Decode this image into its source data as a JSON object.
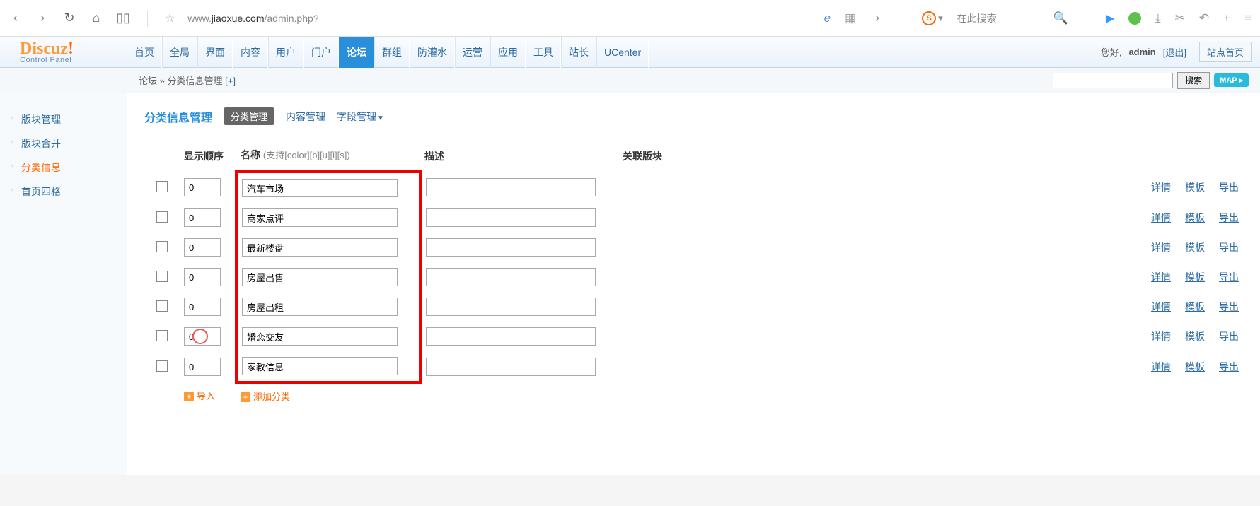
{
  "browser": {
    "url_pre": "www.",
    "url_host": "jiaoxue.com",
    "url_path": "/admin.php?",
    "search_placeholder": "在此搜索"
  },
  "header": {
    "nav": [
      "首页",
      "全局",
      "界面",
      "内容",
      "用户",
      "门户",
      "论坛",
      "群组",
      "防灌水",
      "运营",
      "应用",
      "工具",
      "站长",
      "UCenter"
    ],
    "active_index": 6,
    "greeting": "您好,",
    "user": "admin",
    "logout": "[退出]",
    "site_home": "站点首页"
  },
  "breadcrumb": {
    "part1": "论坛",
    "sep": " » ",
    "part2": "分类信息管理",
    "plus": " [+]",
    "search_btn": "搜索",
    "map": "MAP"
  },
  "sidebar": {
    "items": [
      {
        "label": "版块管理"
      },
      {
        "label": "版块合并"
      },
      {
        "label": "分类信息"
      },
      {
        "label": "首页四格"
      }
    ],
    "active_index": 2
  },
  "page": {
    "title": "分类信息管理",
    "subtabs": {
      "active": "分类管理",
      "content": "内容管理",
      "field": "字段管理"
    }
  },
  "table": {
    "headers": {
      "order": "显示顺序",
      "name": "名称",
      "name_hint": "(支持[color][b][u][i][s])",
      "desc": "描述",
      "related": "关联版块"
    },
    "rows": [
      {
        "order": "0",
        "name": "汽车市场",
        "desc": ""
      },
      {
        "order": "0",
        "name": "商家点评",
        "desc": ""
      },
      {
        "order": "0",
        "name": "最新楼盘",
        "desc": ""
      },
      {
        "order": "0",
        "name": "房屋出售",
        "desc": ""
      },
      {
        "order": "0",
        "name": "房屋出租",
        "desc": ""
      },
      {
        "order": "0",
        "name": "婚恋交友",
        "desc": ""
      },
      {
        "order": "0",
        "name": "家教信息",
        "desc": ""
      }
    ],
    "actions": {
      "detail": "详情",
      "template": "模板",
      "export": "导出"
    },
    "footer": {
      "import": "导入",
      "add": "添加分类"
    }
  }
}
